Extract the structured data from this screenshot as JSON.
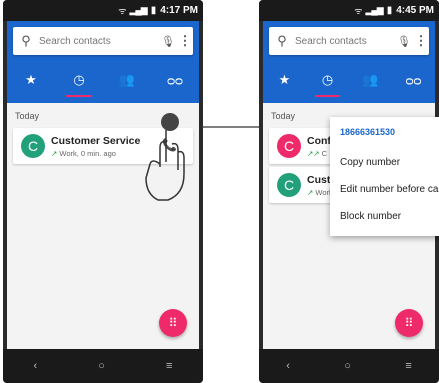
{
  "left": {
    "status_time": "4:17 PM",
    "search_placeholder": "Search contacts",
    "tabs": [
      "favorites-icon",
      "recents-icon",
      "contacts-icon",
      "voicemail-icon"
    ],
    "section": "Today",
    "entries": [
      {
        "initial": "C",
        "name": "Customer Service",
        "detail": "Work, 0 min. ago",
        "color": "#22a07a"
      }
    ]
  },
  "right": {
    "status_time": "4:45 PM",
    "search_placeholder": "Search contacts",
    "section": "Today",
    "entries": [
      {
        "initial": "C",
        "name": "Conference Call",
        "detail": "C",
        "color": "#ef2a6a"
      },
      {
        "initial": "C",
        "name": "Custo",
        "detail": "Work",
        "color": "#22a07a"
      }
    ],
    "menu": {
      "number": "18666361530",
      "items": [
        "Copy number",
        "Edit number before call",
        "Block number"
      ]
    }
  },
  "colors": {
    "accent": "#1a66cc",
    "fab": "#ef2a6a"
  }
}
